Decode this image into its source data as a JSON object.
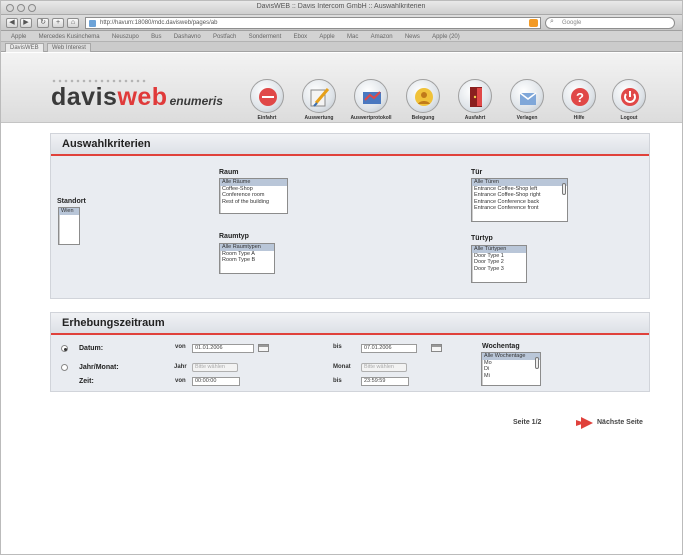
{
  "browser": {
    "window_title": "DavisWEB :: Davis Intercom GmbH :: Auswahlkriterien",
    "url": "http://havum:18080/mdc.davisweb/pages/ab",
    "search_placeholder": "Google",
    "bookmarks": [
      "Apple",
      "Mercedes Kusinchema",
      "Neuszupo",
      "Bus",
      "Dashavno",
      "Postfach",
      "Sonderment",
      "Ebox",
      "Apple",
      "Mac",
      "Amazon",
      "News",
      "Apple (20)"
    ],
    "tabs": [
      "DavisWEB",
      "Web Interest"
    ]
  },
  "app": {
    "logo": {
      "part1": "davis",
      "part2": "web",
      "part3": "enumeris"
    },
    "nav": [
      {
        "label": "Einfahrt",
        "icon": "start-icon"
      },
      {
        "label": "Auswertung",
        "icon": "evaluation-icon"
      },
      {
        "label": "Auswertprotokoll",
        "icon": "protocol-icon"
      },
      {
        "label": "Belegung",
        "icon": "occupancy-icon"
      },
      {
        "label": "Ausfahrt",
        "icon": "door-icon"
      },
      {
        "label": "Verlagen",
        "icon": "archive-icon"
      },
      {
        "label": "Hilfe",
        "icon": "help-icon"
      },
      {
        "label": "Logout",
        "icon": "logout-icon"
      }
    ]
  },
  "criteria": {
    "title": "Auswahlkriterien",
    "standort": {
      "label": "Standort",
      "options": [
        "Wien"
      ]
    },
    "raum": {
      "label": "Raum",
      "options": [
        "Alle Räume",
        "Coffee-Shop",
        "Conference room",
        "Rest of the building"
      ]
    },
    "tuer": {
      "label": "Tür",
      "options": [
        "Alle Türen",
        "Entrance Coffee-Shop left",
        "Entrance Coffee-Shop right",
        "Entrance Conference back",
        "Entrance Conference front"
      ]
    },
    "raumtyp": {
      "label": "Raumtyp",
      "options": [
        "Alle Raumtypen",
        "Room Type A",
        "Room Type B"
      ]
    },
    "tuertyp": {
      "label": "Türtyp",
      "options": [
        "Alle Türtypen",
        "Door Type 1",
        "Door Type 2",
        "Door Type 3"
      ]
    }
  },
  "period": {
    "title": "Erhebungszeitraum",
    "rows": [
      {
        "label": "Datum:",
        "selected": true,
        "from_label": "von",
        "from_value": "01.01.2006",
        "to_label": "bis",
        "to_value": "07.01.2006"
      },
      {
        "label": "Jahr/Monat:",
        "selected": false,
        "from_label": "Jahr",
        "from_value": "Bitte wählen",
        "to_label": "Monat",
        "to_value": "Bitte wählen"
      },
      {
        "label": "Zeit:",
        "from_label": "von",
        "from_value": "00:00:00",
        "to_label": "bis",
        "to_value": "23:59:59"
      }
    ],
    "weekday": {
      "label": "Wochentag",
      "options": [
        "Alle Wochentage",
        "Mo",
        "Di",
        "Mi"
      ]
    }
  },
  "pager": {
    "page": "Seite 1/2",
    "next": "Nächste Seite"
  },
  "colors": {
    "accent": "#e0413b",
    "panel": "#e9ecf1",
    "header_bg": "#dcdcdc"
  }
}
